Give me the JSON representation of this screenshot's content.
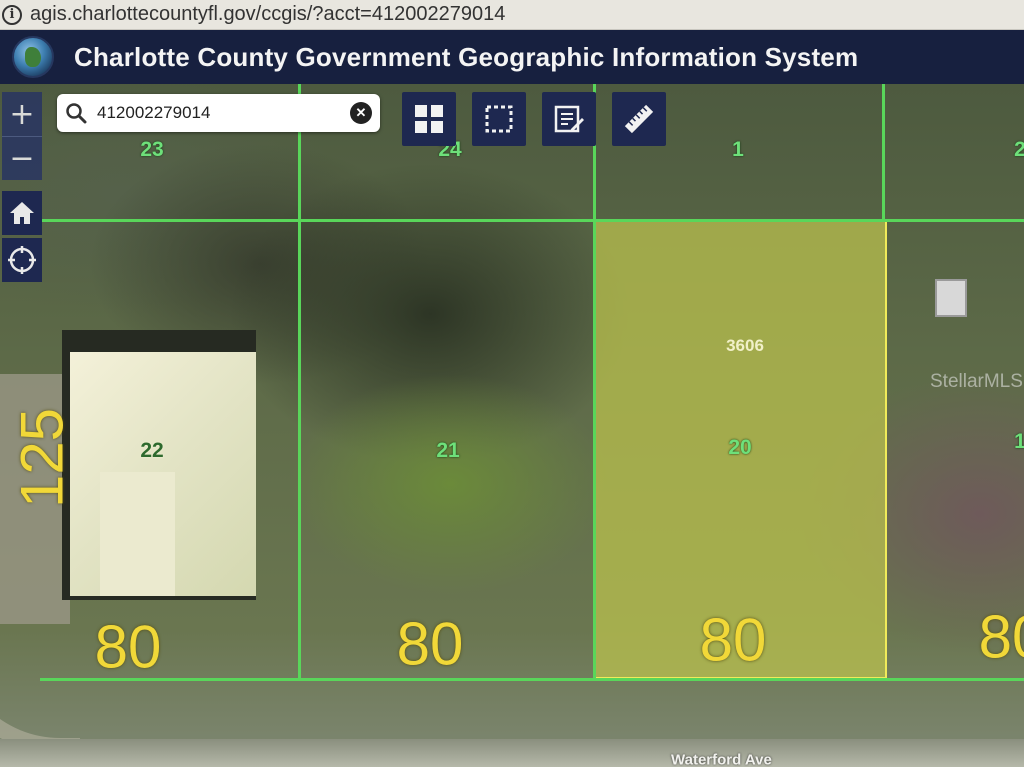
{
  "browser": {
    "url": "agis.charlottecountyfl.gov/ccgis/?acct=412002279014"
  },
  "header": {
    "title": "Charlotte County Government Geographic Information System"
  },
  "search": {
    "value": "412002279014"
  },
  "map": {
    "lot_numbers": {
      "lot_23": "23",
      "lot_24": "24",
      "lot_1": "1",
      "lot_2": "2",
      "lot_22": "22",
      "lot_21": "21",
      "lot_20": "20",
      "lot_19": "1"
    },
    "dimensions": {
      "frontage_1": "80",
      "frontage_2": "80",
      "frontage_3": "80",
      "frontage_4": "80",
      "depth": "125"
    },
    "selected_parcel_address_number": "3606",
    "street_name": "Waterford Ave",
    "watermark": "StellarMLS",
    "colors": {
      "lot_lines": "#59d65a",
      "selected_parcel_outline": "#f0eb5a",
      "dimension_text": "#f1d838"
    }
  },
  "controls": {
    "zoom_in": "+",
    "zoom_out": "−",
    "icons": [
      "home-icon",
      "locate-icon",
      "basemap-grid-icon",
      "select-area-icon",
      "edit-notes-icon",
      "measure-ruler-icon"
    ]
  }
}
